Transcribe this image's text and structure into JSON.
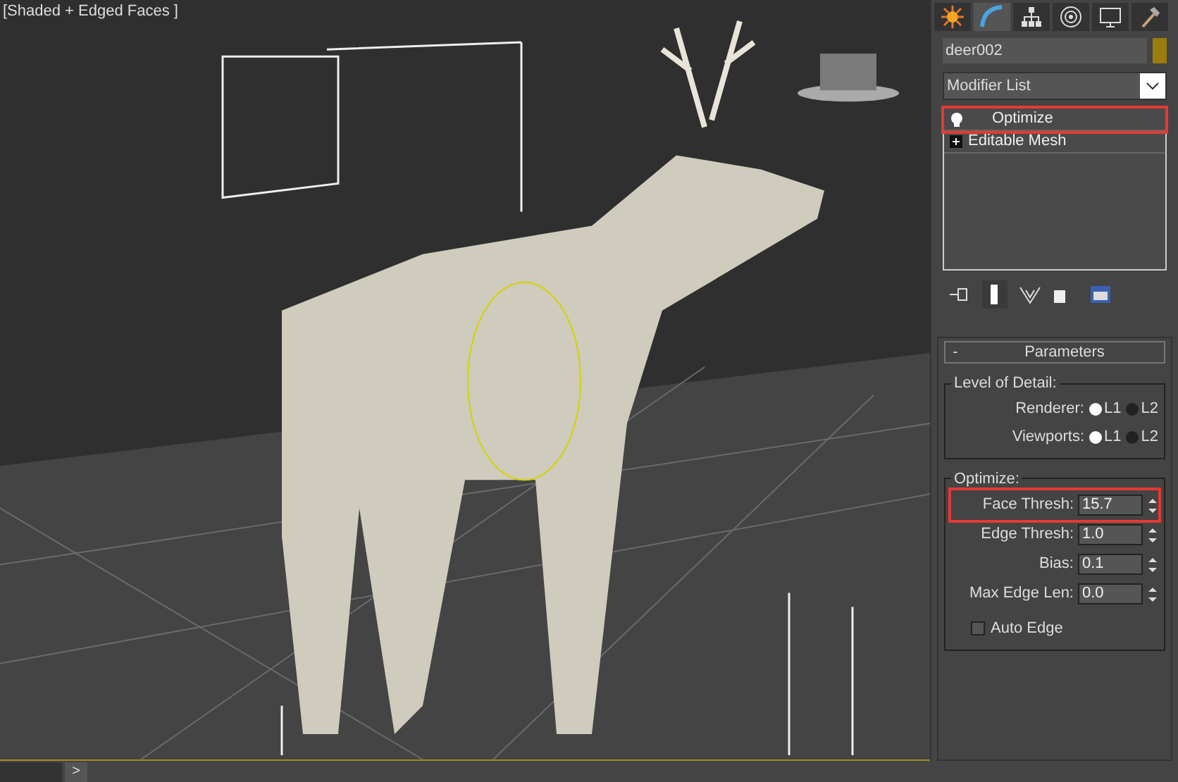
{
  "viewport": {
    "label": "[Shaded + Edged Faces ]"
  },
  "command_panel": {
    "tabs": [
      {
        "selected": false
      },
      {
        "selected": true
      },
      {
        "selected": false
      },
      {
        "selected": false
      },
      {
        "selected": false
      },
      {
        "selected": false
      }
    ],
    "object_name": "deer002",
    "modifier_list": "Modifier List",
    "stack": [
      {
        "label": "Optimize",
        "kind": "modifier",
        "highlighted": true
      },
      {
        "label": "Editable Mesh",
        "kind": "base",
        "highlighted": false
      }
    ],
    "rollout": {
      "title": "Parameters",
      "collapse": "-",
      "level_of_detail": {
        "title": "Level of Detail:",
        "rows": [
          {
            "label": "Renderer:",
            "options": [
              {
                "label": "L1",
                "selected": true
              },
              {
                "label": "L2",
                "selected": false
              }
            ]
          },
          {
            "label": "Viewports:",
            "options": [
              {
                "label": "L1",
                "selected": true
              },
              {
                "label": "L2",
                "selected": false
              }
            ]
          }
        ]
      },
      "optimize": {
        "title": "Optimize:",
        "fields": [
          {
            "label": "Face Thresh:",
            "value": "15.7",
            "highlighted": true
          },
          {
            "label": "Edge Thresh:",
            "value": "1.0",
            "highlighted": false
          },
          {
            "label": "Bias:",
            "value": "0.1",
            "highlighted": false
          },
          {
            "label": "Max Edge Len:",
            "value": "0.0",
            "highlighted": false
          }
        ],
        "auto_edge": {
          "label": "Auto Edge",
          "checked": false
        }
      }
    }
  },
  "status_bar": {
    "button": ">"
  }
}
